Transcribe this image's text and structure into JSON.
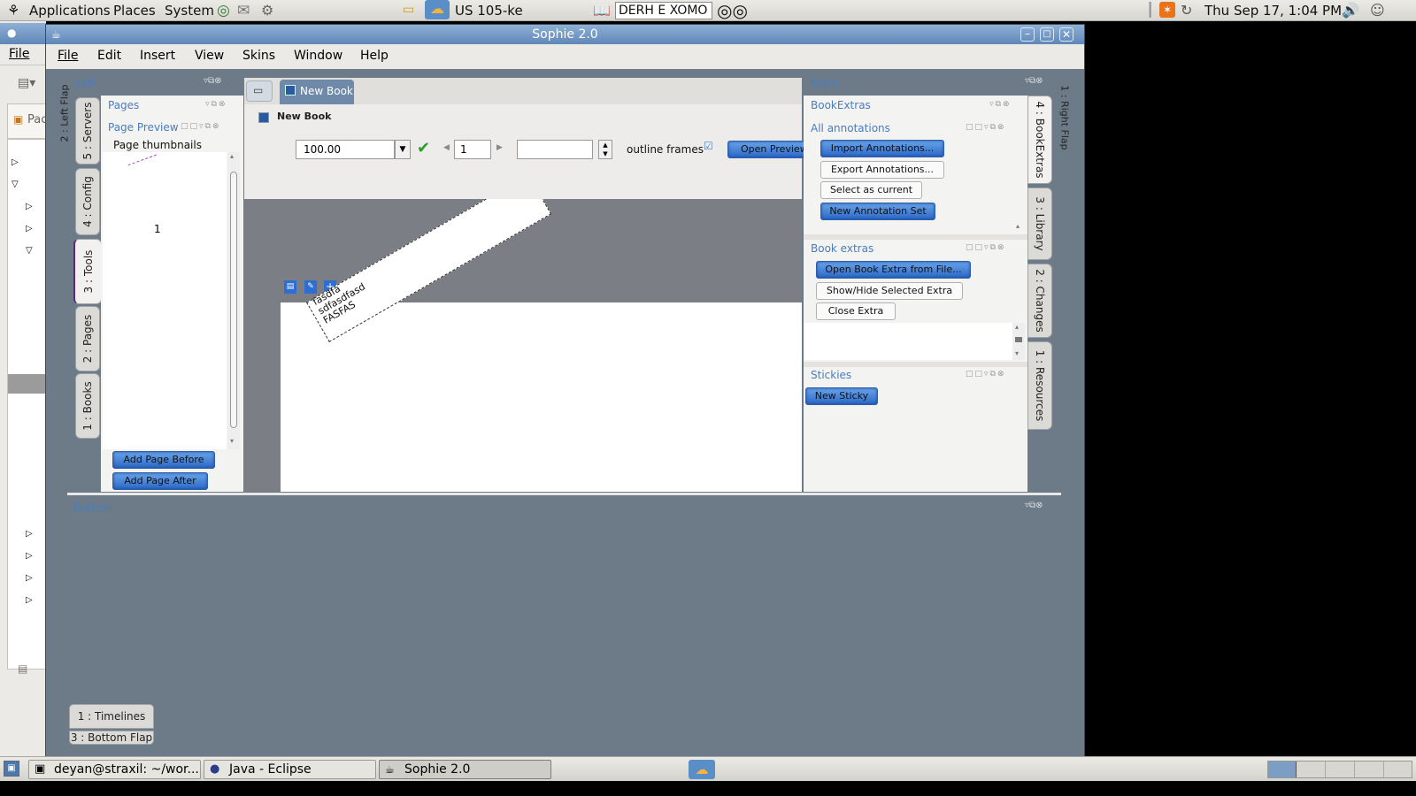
{
  "top_panel": {
    "menu_applications": "Applications",
    "menu_places": "Places",
    "menu_system": "System",
    "weather": "US 105-ke",
    "input_field": "DERH E XOMO",
    "clock": "Thu Sep 17,  1:04 PM"
  },
  "eclipse": {
    "file_menu": "File",
    "tab_label": "Pac"
  },
  "window": {
    "title": "Sophie 2.0",
    "menus": [
      "File",
      "Edit",
      "Insert",
      "View",
      "Skins",
      "Window",
      "Help"
    ]
  },
  "left_flap": {
    "header": "Left",
    "vertical_label": "2 : Left Flap",
    "tabs": [
      "5 : Servers",
      "4 : Config",
      "3 : Tools",
      "2 : Pages",
      "1 : Books"
    ],
    "pages_header": "Pages",
    "page_preview_header": "Page Preview",
    "thumbnails_label": "Page thumbnails",
    "page_number": "1",
    "add_before": "Add Page Before",
    "add_after": "Add Page After"
  },
  "center": {
    "doc_tab": "New Book",
    "subheader": "New Book",
    "zoom_value": "100.00",
    "page_value": "1",
    "outline_frames_label": "outline frames",
    "outline_frames_checked": true,
    "open_preview": "Open Preview",
    "frame_text_lines": [
      "fasdfa",
      "sdfasdfasd",
      "FASFAS"
    ]
  },
  "right_flap": {
    "header": "Right",
    "vertical_label": "1 : Right Flap",
    "tabs": [
      "4 : BookExtras",
      "3 : Library",
      "2 : Changes",
      "1 : Resources"
    ],
    "bookextras_header": "BookExtras",
    "all_annotations_header": "All annotations",
    "import_annotations": "Import Annotations...",
    "export_annotations": "Export Annotations...",
    "select_current": "Select as current",
    "new_annotation_set": "New Annotation Set",
    "book_extras_header": "Book extras",
    "open_extra": "Open Book Extra from File...",
    "show_hide_extra": "Show/Hide  Selected Extra",
    "close_extra": "Close Extra",
    "stickies_header": "Stickies",
    "new_sticky": "New Sticky"
  },
  "bottom_flap": {
    "header": "Bottom",
    "tab_timelines": "1 : Timelines",
    "tab_label": "3 : Bottom Flap"
  },
  "taskbar": {
    "tasks": [
      "deyan@straxil: ~/wor...",
      "Java - Eclipse",
      "Sophie 2.0"
    ]
  },
  "colors": {
    "accent_blue": "#2b68c6",
    "flap_bg": "#6c7b87",
    "header_text": "#4a7cc0"
  }
}
